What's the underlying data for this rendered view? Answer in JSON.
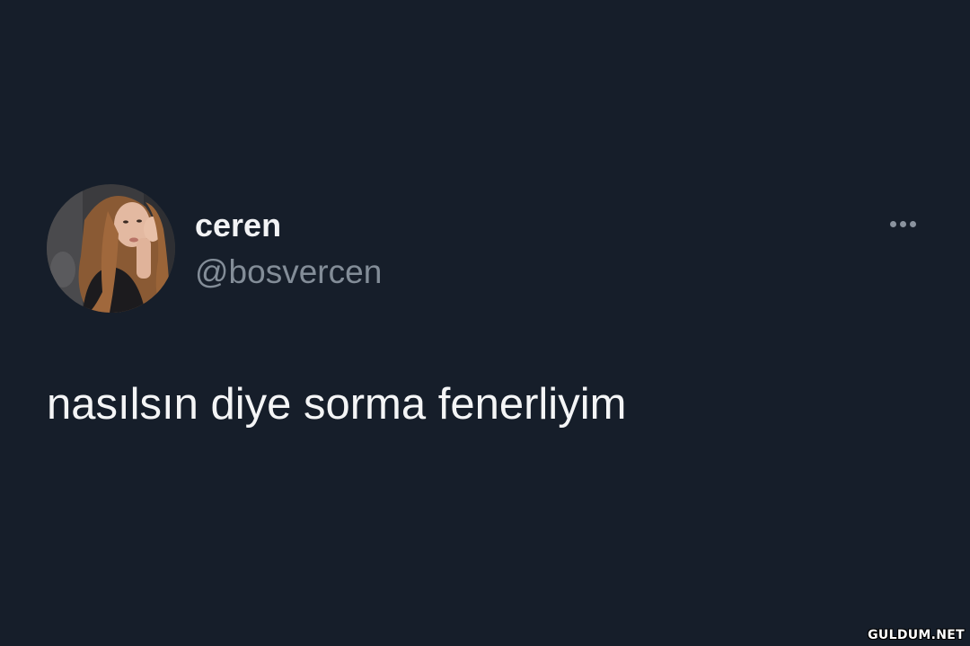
{
  "tweet": {
    "display_name": "ceren",
    "handle": "@bosvercen",
    "text": "nasılsın diye sorma fenerliyim",
    "more_icon": "more-horizontal-icon",
    "avatar_icon": "profile-photo"
  },
  "watermark": {
    "text": "GULDUM.NET"
  },
  "colors": {
    "background": "#161e2a",
    "name": "#f2f3f5",
    "handle": "#838d98",
    "body_text": "#f4f5f6",
    "icon": "#8a939e"
  }
}
